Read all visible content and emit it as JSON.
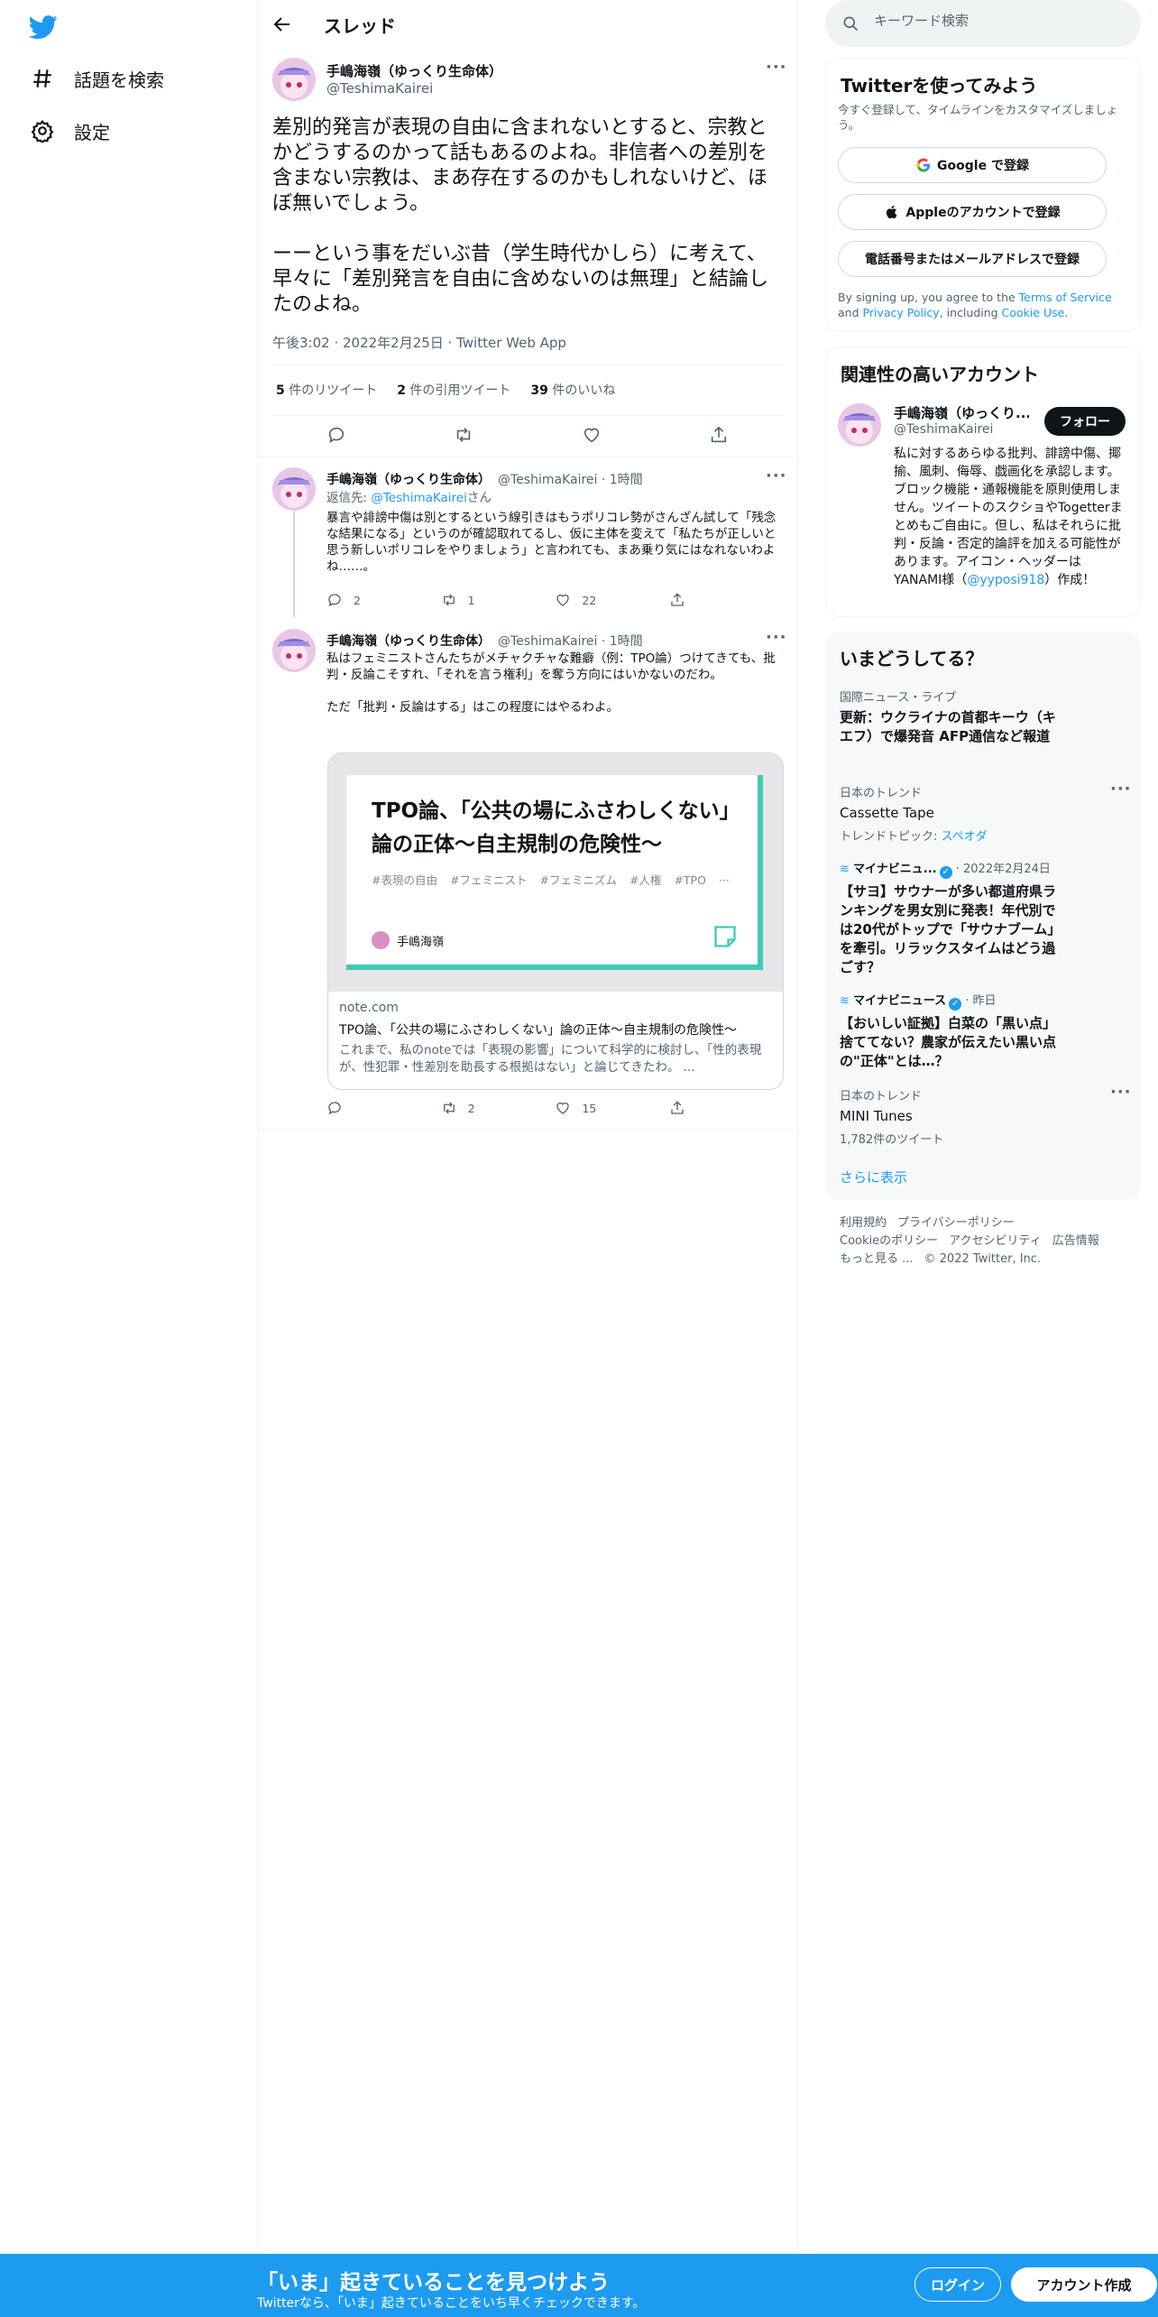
{
  "nav": {
    "items": [
      {
        "icon": "hashtag-icon",
        "label": "話題を検索"
      },
      {
        "icon": "gear-icon",
        "label": "設定"
      }
    ]
  },
  "header": {
    "title": "スレッド"
  },
  "main_tweet": {
    "name": "手嶋海嶺（ゆっくり生命体）",
    "handle": "@TeshimaKairei",
    "text": "差別的発言が表現の自由に含まれないとすると、宗教とかどうするのかって話もあるのよね。非信者への差別を含まない宗教は、まあ存在するのかもしれないけど、ほぼ無いでしょう。\n\nーーという事をだいぶ昔（学生時代かしら）に考えて、早々に「差別発言を自由に含めないのは無理」と結論したのよね。",
    "meta": "午後3:02 · 2022年2月25日 · Twitter Web App",
    "retweets": "5",
    "retweets_label": "件のリツイート",
    "quotes": "2",
    "quotes_label": "件の引用ツイート",
    "likes": "39",
    "likes_label": "件のいいね"
  },
  "replies": [
    {
      "name": "手嶋海嶺（ゆっくり生命体）",
      "handle": "@TeshimaKairei · 1時間",
      "replying_prefix": "返信先: ",
      "replying_to": "@TeshimaKairei",
      "replying_suffix": "さん",
      "text": "暴言や誹謗中傷は別とするという線引きはもうポリコレ勢がさんざん試して「残念な結果になる」というのが確認取れてるし、仮に主体を変えて「私たちが正しいと思う新しいポリコレをやりましょう」と言われても、まあ乗り気にはなれないわよね……。",
      "replies": "2",
      "retweets": "1",
      "likes": "22"
    },
    {
      "name": "手嶋海嶺（ゆっくり生命体）",
      "handle": "@TeshimaKairei · 1時間",
      "text": "私はフェミニストさんたちがメチャクチャな難癖（例：TPO論）つけてきても、批判・反論こそすれ、「それを言う権利」を奪う方向にはいかないのだわ。\n\nただ「批判・反論はする」はこの程度にはやるわよ。",
      "card": {
        "image_title": "TPO論、「公共の場にふさわしくない」論の正体〜自主規制の危険性〜",
        "tags": [
          "#表現の自由",
          "#フェミニスト",
          "#フェミニズム",
          "#人権",
          "#TPO",
          "···"
        ],
        "author": "手嶋海嶺",
        "domain": "note.com",
        "title": "TPO論、「公共の場にふさわしくない」論の正体～自主規制の危険性～",
        "description": "これまで、私のnoteでは「表現の影響」について科学的に検討し、「性的表現が、性犯罪・性差別を助長する根拠はない」と論じてきたわ。 ..."
      },
      "replies": "",
      "retweets": "2",
      "likes": "15"
    }
  ],
  "search": {
    "placeholder": "キーワード検索"
  },
  "signup": {
    "title": "Twitterを使ってみよう",
    "subtitle": "今すぐ登録して、タイムラインをカスタマイズしましょう。",
    "google": "Google で登録",
    "apple": "Appleのアカウントで登録",
    "phone": "電話番号またはメールアドレスで登録",
    "terms_prefix": "By signing up, you agree to the ",
    "terms_link": "Terms of Service",
    "terms_and": " and ",
    "privacy_link": "Privacy Policy",
    "including": ", including ",
    "cookie_link": "Cookie Use",
    "period": "."
  },
  "related": {
    "title": "関連性の高いアカウント",
    "name": "手嶋海嶺（ゆっくり...",
    "handle": "@TeshimaKairei",
    "follow": "フォロー",
    "bio": "私に対するあらゆる批判、誹謗中傷、揶揄、風刺、侮辱、戯画化を承認します。ブロック機能・通報機能を原則使用しません。ツイートのスクショやTogetterまとめもご自由に。但し、私はそれらに批判・反論・否定的論評を加える可能性があります。アイコン・ヘッダーはYANAMI様（",
    "bio_link": "@yyposi918",
    "bio_end": "）作成！"
  },
  "trends": {
    "title": "いまどうしてる？",
    "items": [
      {
        "meta": "国際ニュース・ライブ",
        "title": "更新：ウクライナの首都キーウ（キエフ）で爆発音 AFP通信など報道"
      },
      {
        "meta": "日本のトレンド",
        "title": "Cassette Tape",
        "sub_prefix": "トレンドトピック: ",
        "sub_link": "スペオダ"
      },
      {
        "meta_name": "マイナビニュ...",
        "meta_date": " · 2022年2月24日",
        "title": "【サヨ】サウナーが多い都道府県ランキングを男女別に発表！年代別では20代がトップで「サウナブーム」を牽引。リラックスタイムはどう過ごす？"
      },
      {
        "meta_name": "マイナビニュース",
        "meta_date": " · 昨日",
        "title": "【おいしい証拠】白菜の「黒い点」捨ててない？農家が伝えたい黒い点の\"正体\"とは…？"
      },
      {
        "meta": "日本のトレンド",
        "title": "MINI Tunes",
        "sub": "1,782件のツイート"
      }
    ],
    "show_more": "さらに表示"
  },
  "footer": {
    "links": [
      "利用規約",
      "プライバシーポリシー",
      "Cookieのポリシー",
      "アクセシビリティ",
      "広告情報",
      "もっと見る ..."
    ],
    "copyright": "© 2022 Twitter, Inc."
  },
  "bottom_bar": {
    "title": "「いま」起きていることを見つけよう",
    "subtitle": "Twitterなら、「いま」起きていることをいち早くチェックできます。",
    "login": "ログイン",
    "signup": "アカウント作成"
  },
  "colors": {
    "accent": "#1d9bf0",
    "text": "#0f1419",
    "muted": "#536471",
    "note_green": "#41c9b4"
  }
}
